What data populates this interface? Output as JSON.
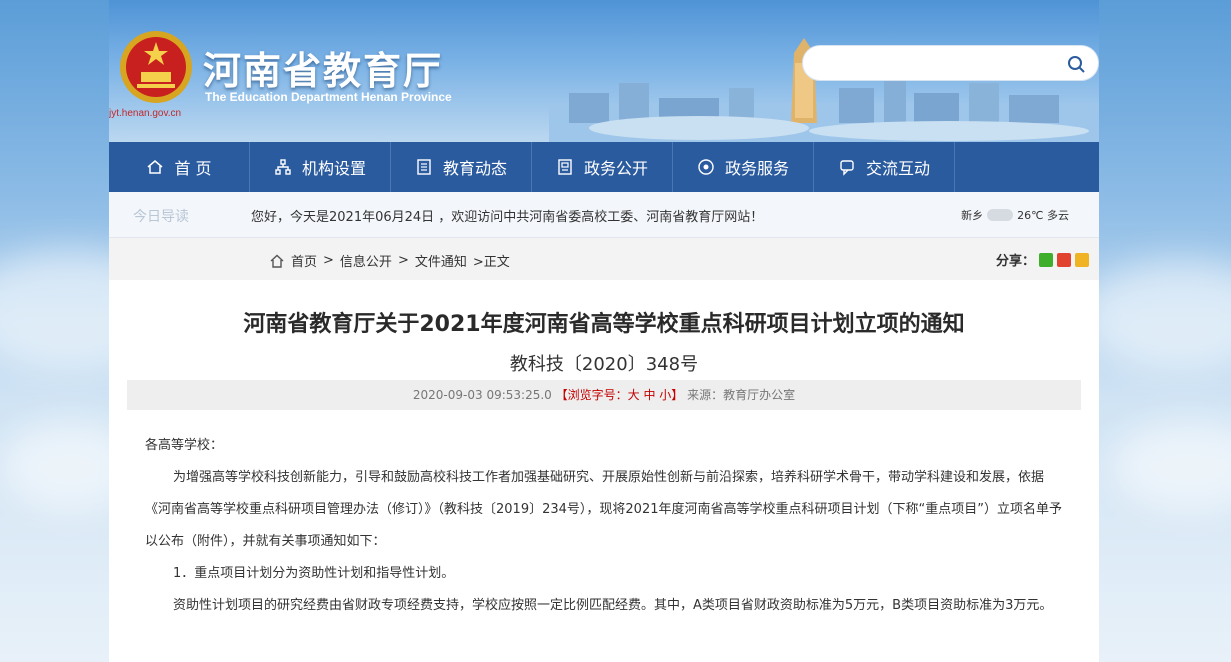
{
  "header": {
    "site_title": "河南省教育厅",
    "site_subtitle": "The Education Department Henan Province",
    "site_url": "jyt.henan.gov.cn",
    "search_placeholder": ""
  },
  "nav": {
    "items": [
      {
        "label": "首 页",
        "icon": "home-icon"
      },
      {
        "label": "机构设置",
        "icon": "org-icon"
      },
      {
        "label": "教育动态",
        "icon": "news-icon"
      },
      {
        "label": "政务公开",
        "icon": "document-icon"
      },
      {
        "label": "政务服务",
        "icon": "service-icon"
      },
      {
        "label": "交流互动",
        "icon": "chat-icon"
      }
    ]
  },
  "notice": {
    "label": "今日导读",
    "text": "您好，今天是2021年06月24日 ，欢迎访问中共河南省委高校工委、河南省教育厅网站！",
    "weather_city": "新乡",
    "weather_temp": "26℃ 多云"
  },
  "breadcrumb": {
    "home": "首页",
    "sep1": ">",
    "level2": "信息公开",
    "sep2": ">",
    "level3": "文件通知",
    "current": ">正文"
  },
  "share": {
    "label": "分享："
  },
  "article": {
    "title": "河南省教育厅关于2021年度河南省高等学校重点科研项目计划立项的通知",
    "doc_number": "教科技〔2020〕348号",
    "date": "2020-09-03 09:53:25.0",
    "font_size_text": "【浏览字号：大 中 小】",
    "source": "来源：教育厅办公室",
    "salutation": "各高等学校：",
    "para1": "为增强高等学校科技创新能力，引导和鼓励高校科技工作者加强基础研究、开展原始性创新与前沿探索，培养科研学术骨干，带动学科建设和发展，依据《河南省高等学校重点科研项目管理办法（修订）》（教科技〔2019〕234号），现将2021年度河南省高等学校重点科研项目计划（下称“重点项目”）立项名单予以公布（附件），并就有关事项通知如下：",
    "para2": "1．重点项目计划分为资助性计划和指导性计划。",
    "para3": "资助性计划项目的研究经费由省财政专项经费支持，学校应按照一定比例匹配经费。其中，A类项目省财政资助标准为5万元，B类项目资助标准为3万元。"
  },
  "colors": {
    "nav_bg": "#2b5b9f",
    "accent_red": "#c40000"
  }
}
